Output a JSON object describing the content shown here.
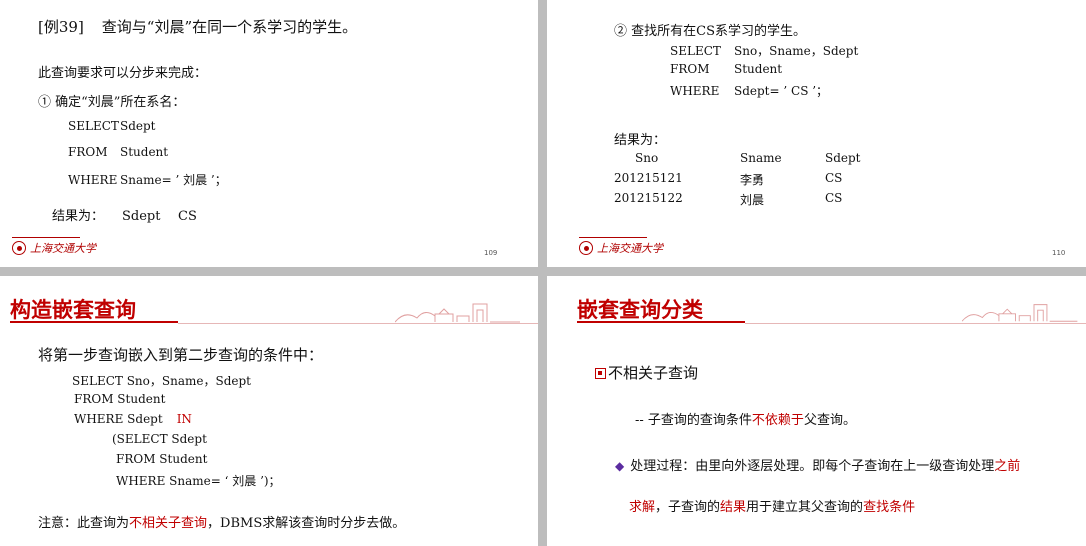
{
  "logo": {
    "script": "上海交通大学"
  },
  "slide109": {
    "title_tag": "[例39]",
    "title_text": "查询与“刘晨”在同一个系学习的学生。",
    "intro": "此查询要求可以分步来完成：",
    "step1": "① 确定“刘晨”所在系名：",
    "sql": [
      {
        "kw": "SELECT",
        "arg": "Sdept"
      },
      {
        "kw": "FROM",
        "arg": "Student"
      },
      {
        "kw": "WHERE",
        "arg": "Sname= ’ 刘晨 ’；"
      }
    ],
    "result_label": "结果为：",
    "result_col": "Sdept",
    "result_val": "CS",
    "page": "109"
  },
  "slide110": {
    "step2": "② 查找所有在CS系学习的学生。",
    "sql": [
      {
        "kw": "SELECT",
        "arg": "Sno，Sname，Sdept"
      },
      {
        "kw": "FROM",
        "arg": "Student"
      },
      {
        "kw": "WHERE",
        "arg": "Sdept= ’ CS ’；"
      }
    ],
    "result_label": "结果为：",
    "table": {
      "headers": [
        "Sno",
        "Sname",
        "Sdept"
      ],
      "rows": [
        [
          "201215121",
          "李勇",
          "CS"
        ],
        [
          "201215122",
          "刘晨",
          "CS"
        ]
      ]
    },
    "page": "110"
  },
  "slide_nested": {
    "title": "构造嵌套查询",
    "intro": "将第一步查询嵌入到第二步查询的条件中：",
    "line1": "SELECT Sno，Sname，Sdept",
    "line2": "FROM Student",
    "line3_pre": "WHERE Sdept",
    "line3_kw": "IN",
    "line4": "(SELECT Sdept",
    "line5": "FROM Student",
    "line6": "WHERE Sname=  ‘ 刘晨 ’)；",
    "note_pre": "注意：此查询为",
    "note_red": "不相关子查询",
    "note_post": "，DBMS求解该查询时分步去做。"
  },
  "slide_classify": {
    "title": "嵌套查询分类",
    "heading": "不相关子查询",
    "line1_pre": "-- 子查询的查询条件",
    "line1_red": "不依赖于",
    "line1_post": "父查询。",
    "line2_pre": "处理过程：由里向外逐层处理。即每个子查询在上一级查询处理",
    "line2_red": "之前",
    "line3_red1": "求解",
    "line3_mid1": "，子查询的",
    "line3_red2": "结果",
    "line3_mid2": "用于建立其父查询的",
    "line3_red3": "查找条件"
  },
  "colors": {
    "accent_red": "#c00000",
    "bullet_purple": "#5b2ca0"
  }
}
